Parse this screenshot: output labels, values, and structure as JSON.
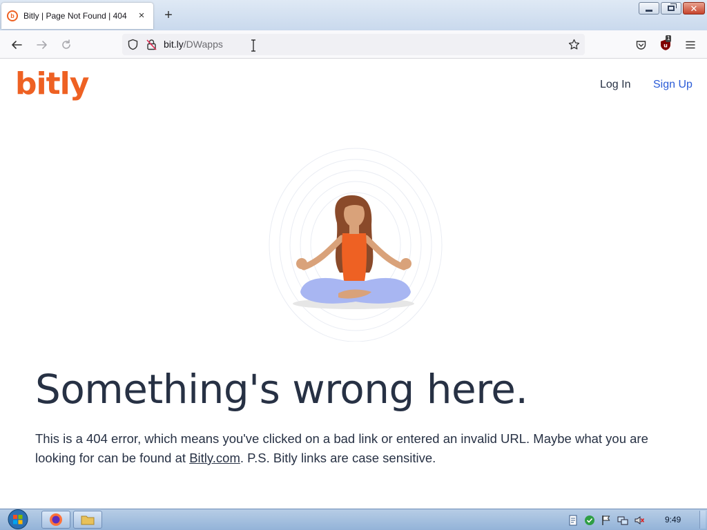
{
  "browser": {
    "tab_title": "Bitly | Page Not Found | 404",
    "tab_favicon": "b",
    "new_tab_label": "+",
    "close_tab_label": "×",
    "url_domain": "bit.ly",
    "url_path": "/DWapps",
    "extension_badge": "1"
  },
  "page": {
    "logo": "bitly",
    "login": "Log In",
    "signup": "Sign Up",
    "headline": "Something's wrong here.",
    "body_prefix": "This is a 404 error, which means you've clicked on a bad link or entered an invalid URL. Maybe what you are looking for can be found at ",
    "body_link": "Bitly.com",
    "body_suffix": ". P.S. Bitly links are case sensitive."
  },
  "taskbar": {
    "clock": "9:49"
  },
  "colors": {
    "brand_orange": "#ee6123",
    "link_blue": "#2a5bd7",
    "text_dark": "#273144"
  }
}
